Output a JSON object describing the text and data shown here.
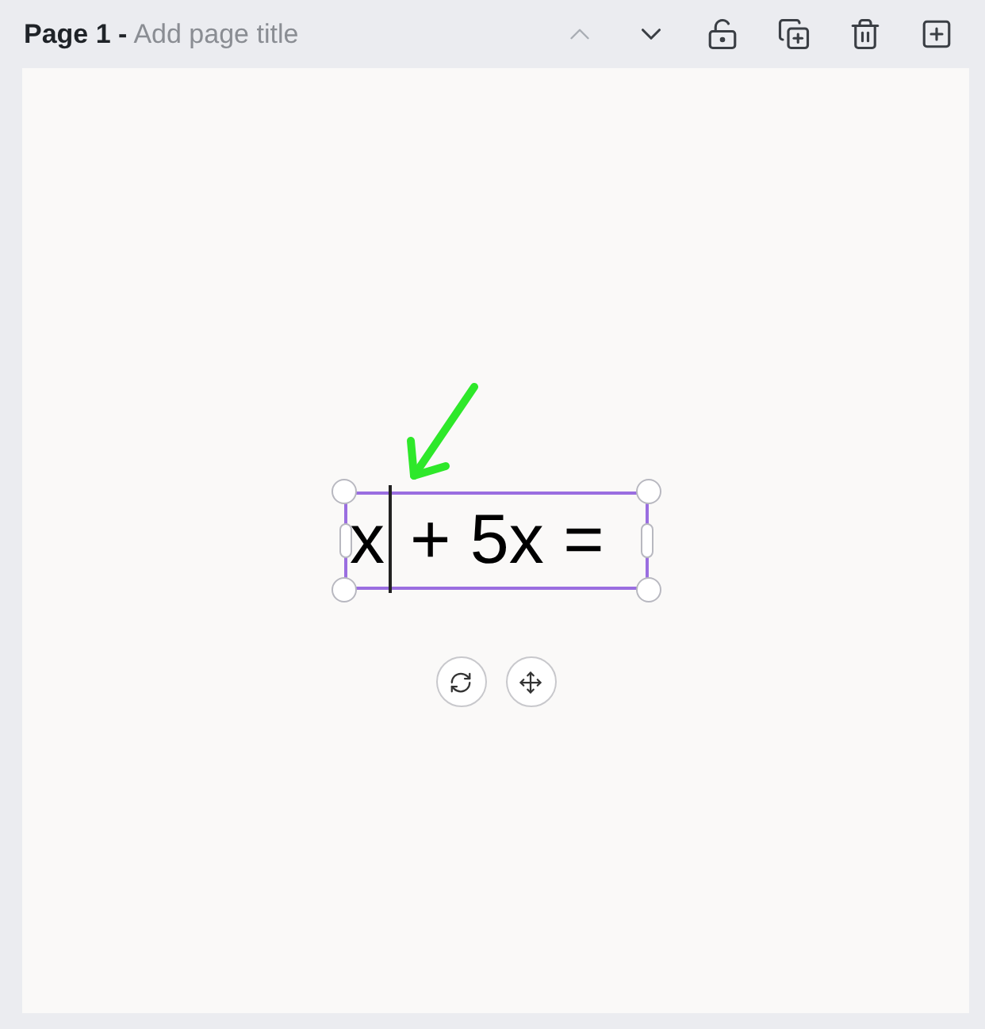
{
  "page_header": {
    "page_label": "Page 1 -",
    "title_placeholder": "Add page title"
  },
  "toolbar": [
    {
      "kind": "up",
      "disabled": true
    },
    {
      "kind": "down",
      "disabled": false
    },
    {
      "kind": "lock",
      "disabled": false
    },
    {
      "kind": "duplicate",
      "disabled": false
    },
    {
      "kind": "delete",
      "disabled": false
    },
    {
      "kind": "add",
      "disabled": false
    }
  ],
  "text_box": {
    "selected": true,
    "text_before_cursor": "x",
    "text_after_cursor": "+ 5x ="
  },
  "float_controls": [
    {
      "kind": "rotate"
    },
    {
      "kind": "move"
    }
  ]
}
